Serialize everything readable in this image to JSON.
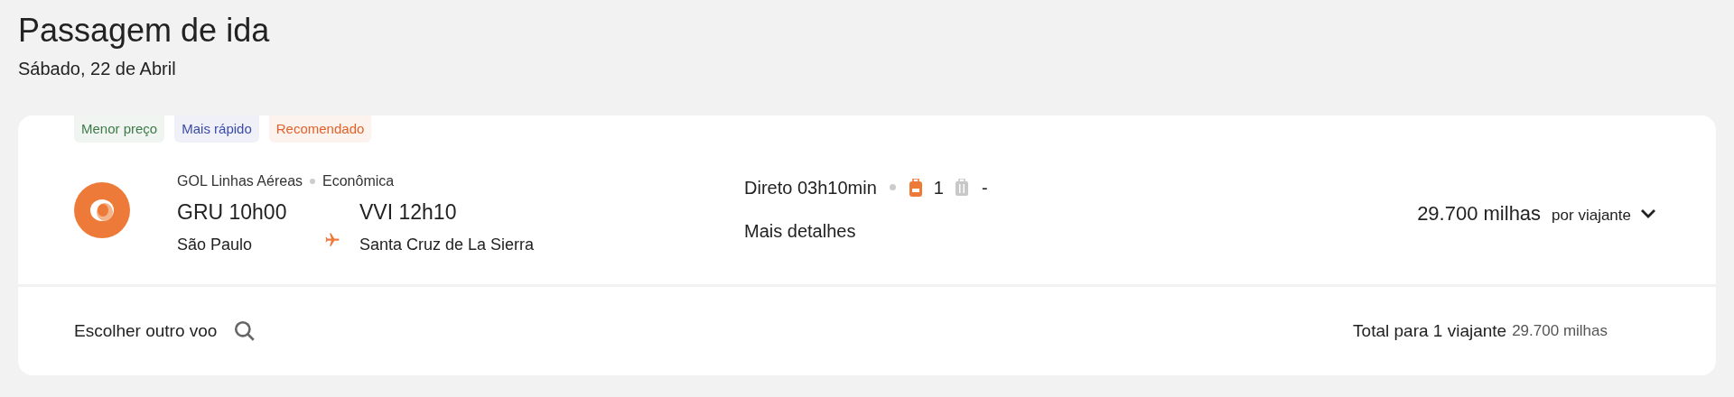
{
  "header": {
    "title": "Passagem de ida",
    "date": "Sábado, 22 de Abril"
  },
  "tags": [
    {
      "label": "Menor preço",
      "color": "#3d7a47"
    },
    {
      "label": "Mais rápido",
      "color": "#3a4aa8"
    },
    {
      "label": "Recomendado",
      "color": "#e0622a"
    }
  ],
  "flight": {
    "airline": "GOL Linhas Aéreas",
    "cabin": "Econômica",
    "origin": {
      "time": "GRU 10h00",
      "city": "São Paulo"
    },
    "destination": {
      "time": "VVI 12h10",
      "city": "Santa Cruz de La Sierra"
    },
    "duration": "Direto 03h10min",
    "carry_on": "1",
    "checked_bag": "-",
    "details_link": "Mais detalhes",
    "price": "29.700 milhas",
    "price_unit": "por viajante",
    "expanded": false
  },
  "footer": {
    "choose_other": "Escolher outro voo",
    "total_label": "Total para 1 viajante",
    "total_value": "29.700 milhas"
  }
}
